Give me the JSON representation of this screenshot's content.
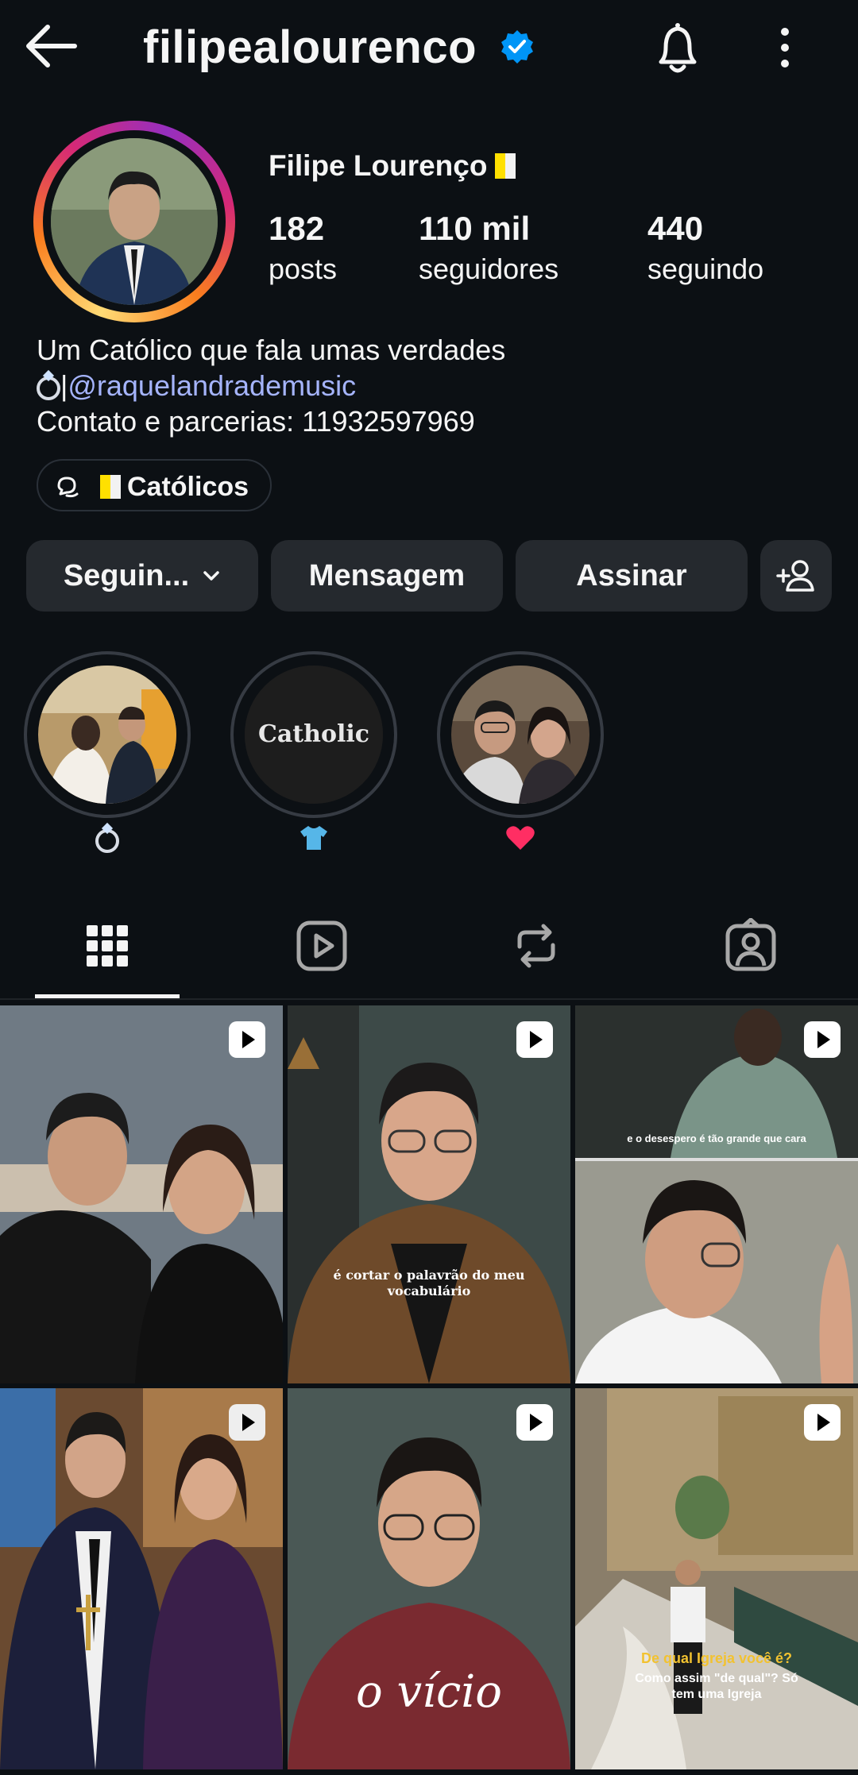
{
  "header": {
    "username": "filipealourenco",
    "verified": true
  },
  "profile": {
    "display_name": "Filipe Lourenço",
    "stats": [
      {
        "value": "182",
        "label": "posts"
      },
      {
        "value": "110 mil",
        "label": "seguidores"
      },
      {
        "value": "440",
        "label": "seguindo"
      }
    ],
    "bio_line1": "Um Católico que fala umas verdades",
    "bio_line2_sep": "|",
    "bio_mention": "@raquelandrademusic",
    "bio_line3": "Contato e parcerias: 11932597969",
    "group_chip": "Católicos"
  },
  "actions": {
    "following": "Seguin...",
    "message": "Mensagem",
    "subscribe": "Assinar"
  },
  "highlights": [
    {
      "icon": "ring-icon"
    },
    {
      "icon": "shirt-icon",
      "cover_text": "Catholic"
    },
    {
      "icon": "heart-icon"
    }
  ],
  "tabs": [
    "grid-icon",
    "reels-icon",
    "reposts-icon",
    "tagged-icon"
  ],
  "posts": [
    {
      "caption": ""
    },
    {
      "caption": "é cortar o palavrão do meu vocabulário"
    },
    {
      "caption": "e o desespero é tão grande que cara"
    },
    {
      "caption": ""
    },
    {
      "caption": "o vício"
    },
    {
      "caption_q": "De qual Igreja você é?",
      "caption_a": "Como assim \"de qual\"? Só tem uma Igreja"
    }
  ],
  "colors": {
    "background": "#0c1014",
    "button": "#25292e",
    "mention": "#a5b4fc",
    "verified": "#0095f6"
  }
}
